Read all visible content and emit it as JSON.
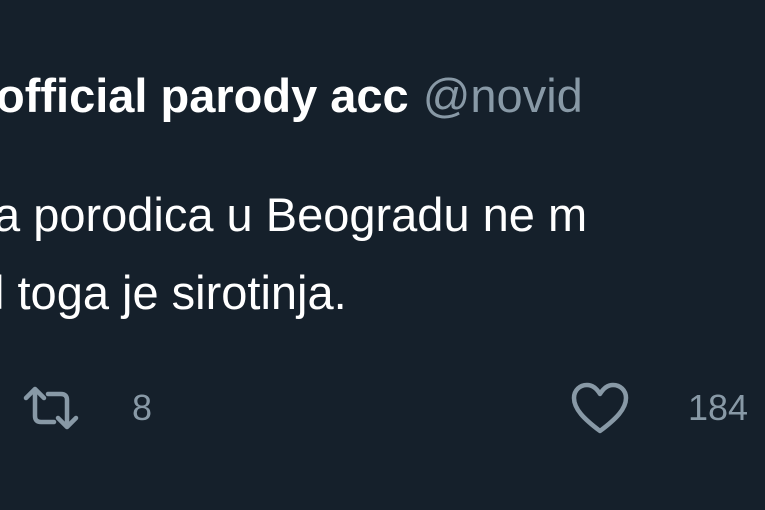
{
  "tweet": {
    "display_name": "official parody acc",
    "handle": "@novid",
    "text_lines": [
      "a porodica u Beogradu ne m",
      "l toga je sirotinja."
    ]
  },
  "actions": {
    "retweet": {
      "icon": "retweet-icon",
      "count": "8"
    },
    "like": {
      "icon": "heart-icon",
      "count": "184"
    }
  },
  "colors": {
    "background": "#15202b",
    "text_primary": "#ffffff",
    "text_secondary": "#8899a6"
  }
}
